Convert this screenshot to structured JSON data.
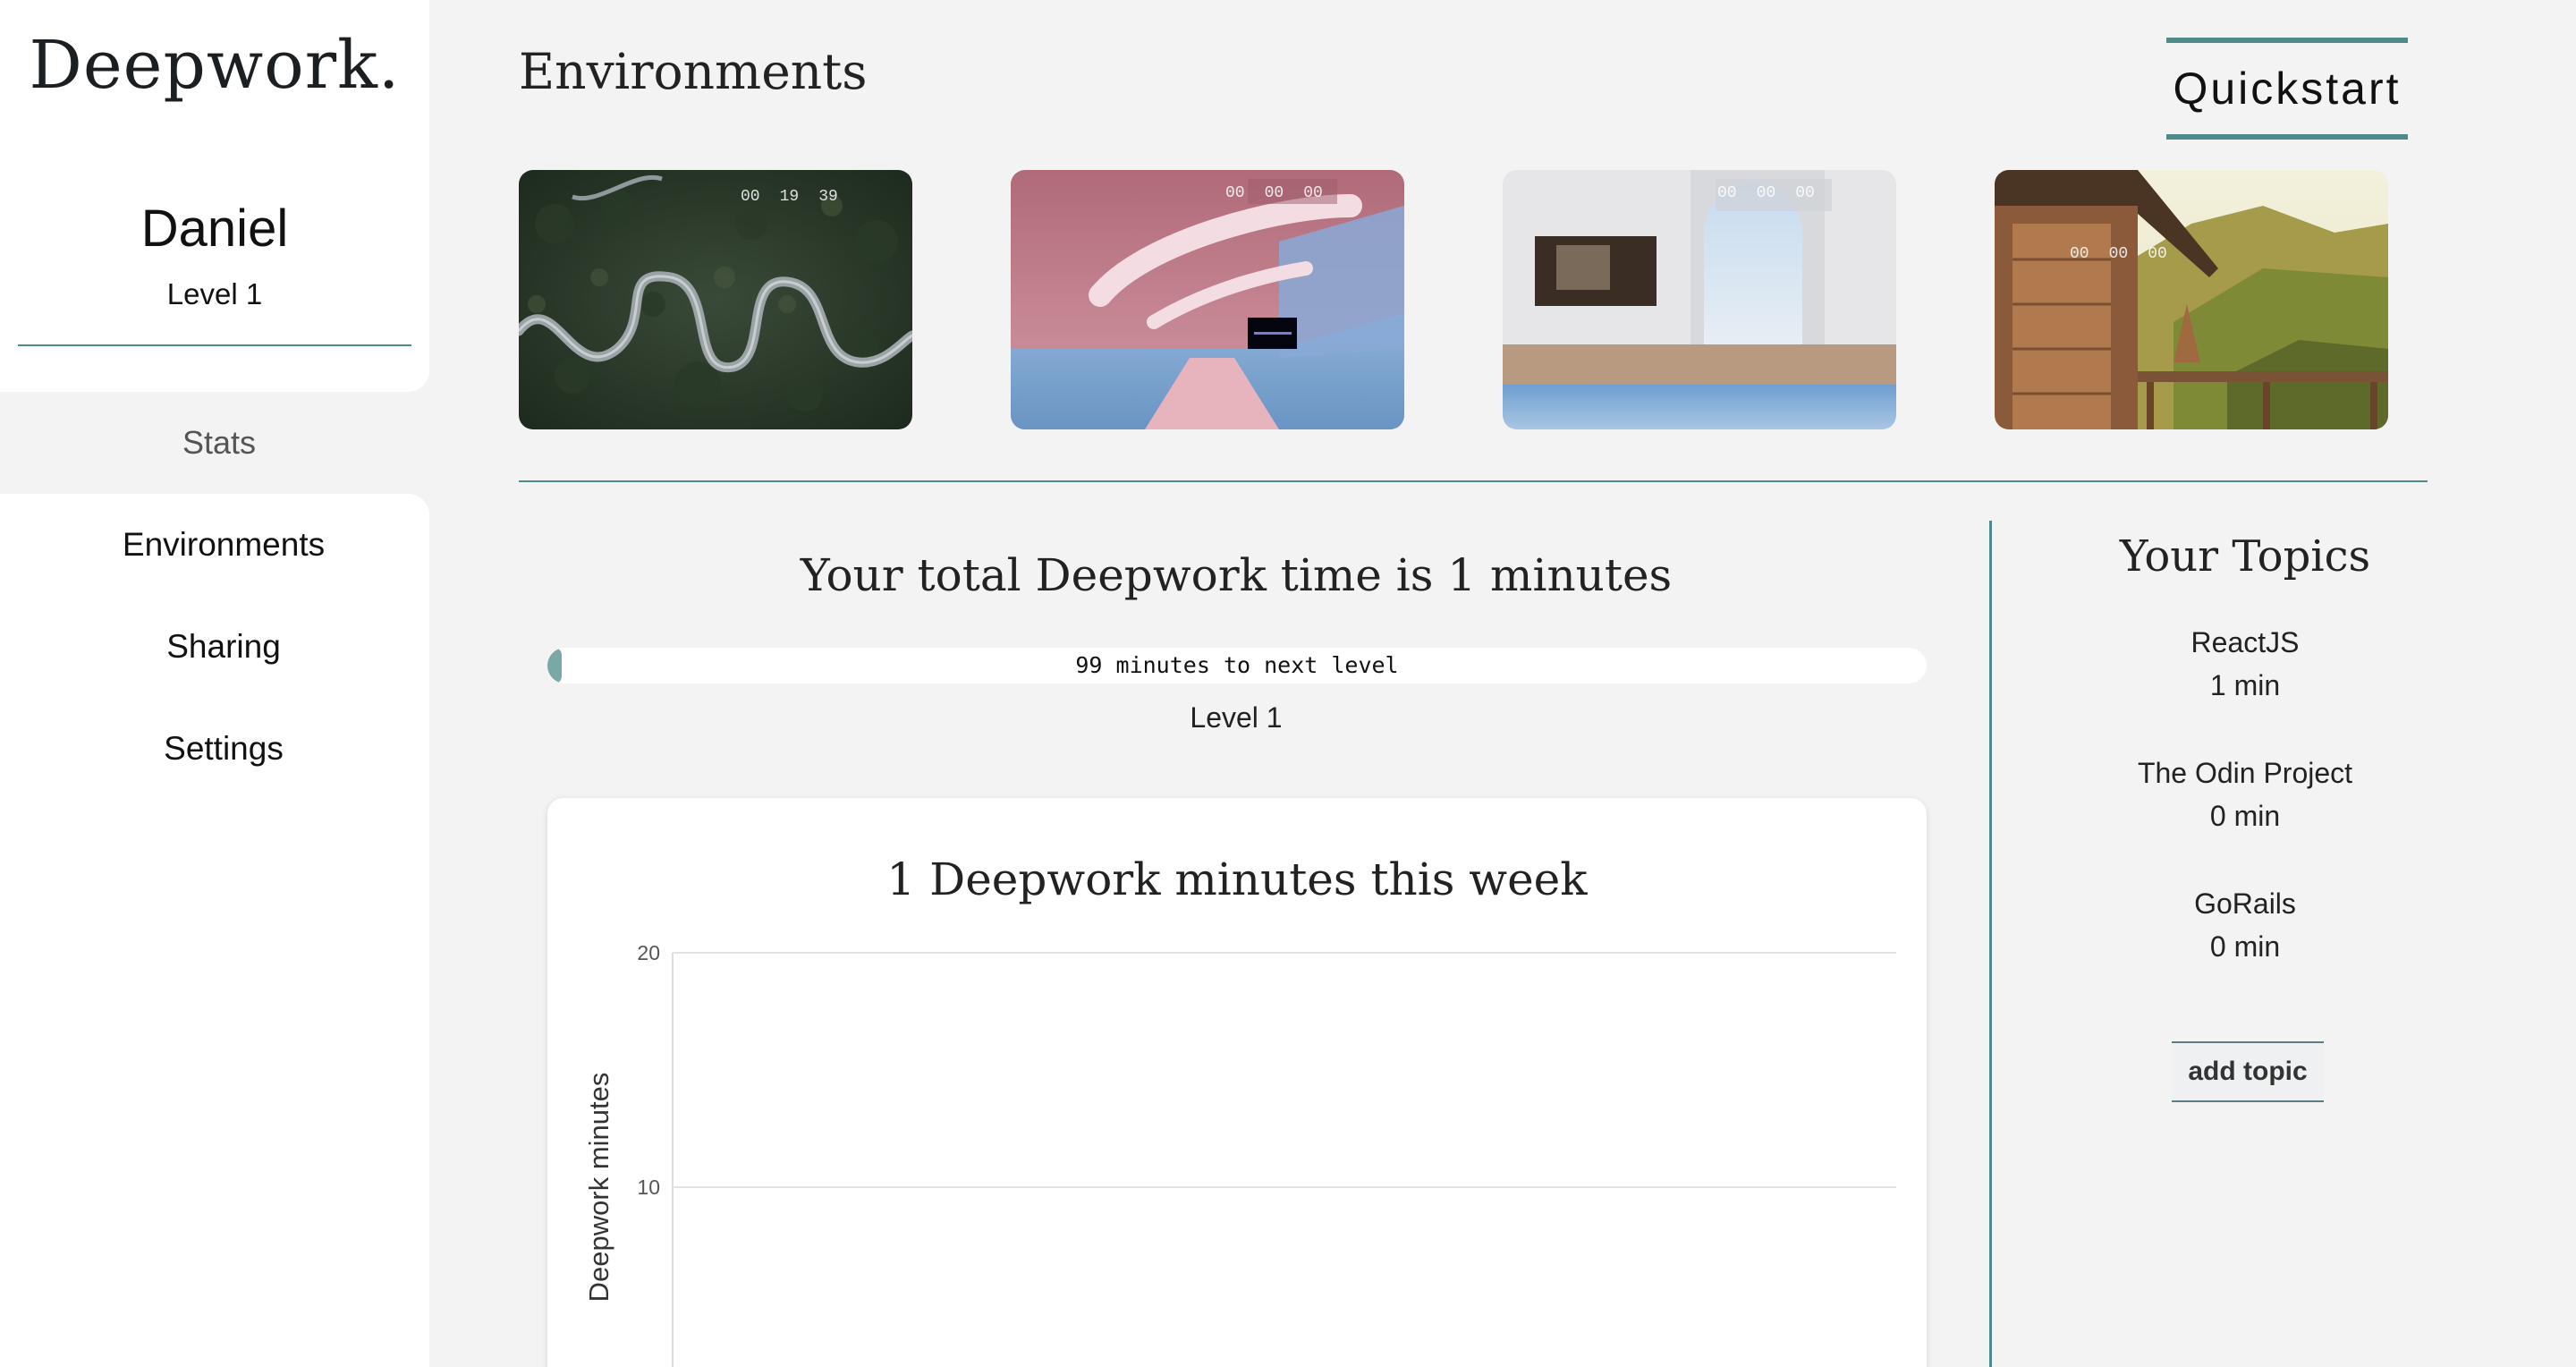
{
  "sidebar": {
    "logo": "Deepwork.",
    "user_name": "Daniel",
    "user_level": "Level 1",
    "nav": [
      {
        "label": "Stats",
        "active": true
      },
      {
        "label": "Environments"
      },
      {
        "label": "Sharing"
      },
      {
        "label": "Settings"
      }
    ]
  },
  "environments": {
    "heading": "Environments",
    "quickstart_label": "Quickstart",
    "cards": [
      {
        "name": "forest-road",
        "timer": [
          "00",
          "19",
          "39"
        ]
      },
      {
        "name": "pink-tunnel",
        "timer": [
          "00",
          "00",
          "00"
        ]
      },
      {
        "name": "white-arch-pool",
        "timer": [
          "00",
          "00",
          "00"
        ]
      },
      {
        "name": "mountain-cabin",
        "timer": [
          "00",
          "00",
          "00"
        ]
      }
    ]
  },
  "stats": {
    "total_title": "Your total Deepwork time is 1 minutes",
    "progress_label": "99 minutes to next level",
    "progress_fraction": 0.01,
    "level_label": "Level 1"
  },
  "chart_data": {
    "type": "bar",
    "title": "1 Deepwork minutes this week",
    "ylabel": "Deepwork minutes",
    "xlabel": "",
    "ylim": [
      0,
      20
    ],
    "yticks": [
      10,
      20
    ],
    "grid": true
  },
  "topics": {
    "title": "Your Topics",
    "items": [
      {
        "name": "ReactJS",
        "time": "1 min"
      },
      {
        "name": "The Odin Project",
        "time": "0 min"
      },
      {
        "name": "GoRails",
        "time": "0 min"
      }
    ],
    "add_label": "add topic"
  },
  "colors": {
    "accent": "#4e8a89",
    "progress_fill": "#7aa8a6",
    "background": "#f3f3f3"
  }
}
